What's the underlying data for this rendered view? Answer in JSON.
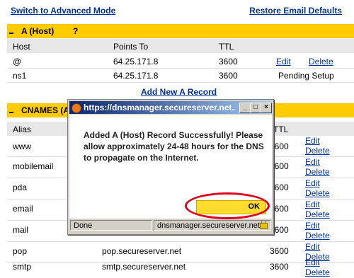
{
  "topbar": {
    "advanced_link": "Switch to Advanced Mode",
    "restore_link": "Restore Email Defaults"
  },
  "a_section": {
    "title": "A (Host)",
    "help_icon": "?",
    "columns": {
      "host": "Host",
      "points_to": "Points To",
      "ttl": "TTL"
    },
    "rows": [
      {
        "host": "@",
        "points_to": "64.25.171.8",
        "ttl": "3600",
        "edit": "Edit",
        "delete": "Delete"
      },
      {
        "host": "ns1",
        "points_to": "64.25.171.8",
        "ttl": "3600",
        "status": "Pending Setup"
      }
    ],
    "add_link": "Add New A Record"
  },
  "cname_section": {
    "title": "CNAMES (Ali",
    "columns": {
      "alias": "Alias",
      "ttl": "TTL"
    },
    "rows": [
      {
        "alias": "www",
        "points_to": "",
        "ttl": "3600",
        "edit": "Edit",
        "delete": "Delete"
      },
      {
        "alias": "mobilemail",
        "points_to": "",
        "ttl": "3600",
        "edit": "Edit",
        "delete": "Delete"
      },
      {
        "alias": "pda",
        "points_to": "",
        "ttl": "3600",
        "edit": "Edit",
        "delete": "Delete"
      },
      {
        "alias": "email",
        "points_to": "",
        "ttl": "3600",
        "edit": "Edit",
        "delete": "Delete"
      },
      {
        "alias": "mail",
        "points_to": "",
        "ttl": "3600",
        "edit": "Edit",
        "delete": "Delete"
      },
      {
        "alias": "pop",
        "points_to": "pop.secureserver.net",
        "ttl": "3600",
        "edit": "Edit",
        "delete": "Delete"
      },
      {
        "alias": "smtp",
        "points_to": "smtp.secureserver.net",
        "ttl": "3600",
        "edit": "Edit",
        "delete": "Delete"
      }
    ]
  },
  "popup": {
    "title": "https://dnsmanager.secureserver.net...",
    "message": "Added A (Host) Record Successfully! Please allow approximately 24-48 hours for the DNS to propagate on the Internet.",
    "ok_label": "OK",
    "status_left": "Done",
    "status_right": "dnsmanager.secureserver.net",
    "controls": {
      "minimize": "_",
      "maximize": "□",
      "close": "×"
    }
  },
  "colors": {
    "section_header": "#ffcc00",
    "link": "#003399",
    "highlight_ring": "#e0001b"
  }
}
